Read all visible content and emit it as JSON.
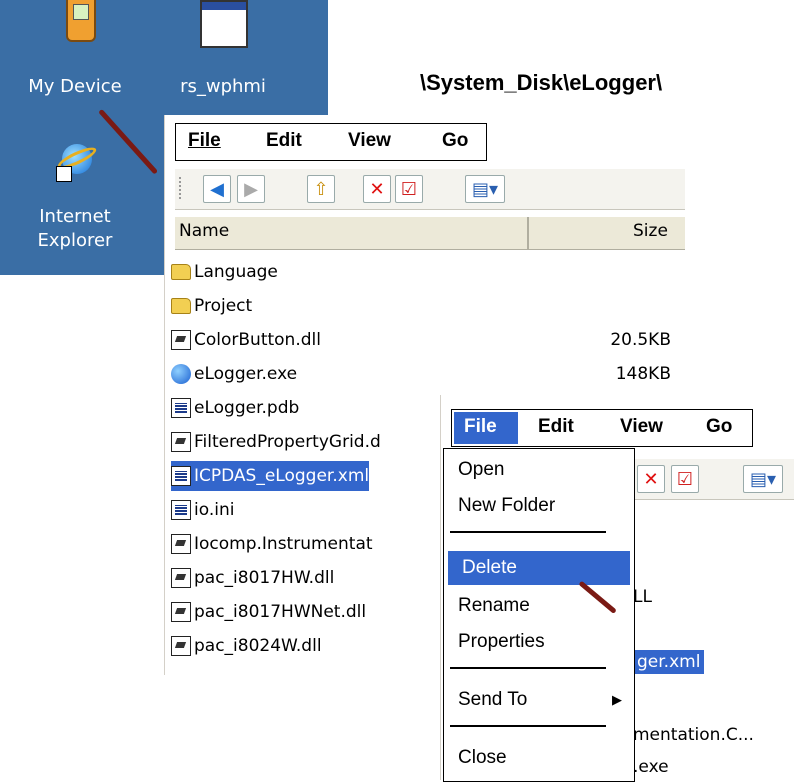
{
  "desktop": {
    "icons": [
      {
        "label": "My Device",
        "icon": "pda-icon"
      },
      {
        "label": "rs_wphmi",
        "icon": "window-icon"
      },
      {
        "label_line1": "Internet",
        "label_line2": "Explorer",
        "icon": "internet-explorer-icon"
      }
    ]
  },
  "path_label": "\\System_Disk\\eLogger\\",
  "explorer": {
    "menu": [
      "File",
      "Edit",
      "View",
      "Go"
    ],
    "toolbar": [
      "back-icon",
      "forward-icon",
      "up-folder-icon",
      "delete-icon",
      "properties-icon",
      "view-icon"
    ],
    "columns": {
      "name": "Name",
      "size": "Size"
    },
    "files": [
      {
        "name": "Language",
        "type": "folder",
        "size": ""
      },
      {
        "name": "Project",
        "type": "folder",
        "size": ""
      },
      {
        "name": "ColorButton.dll",
        "type": "dll",
        "size": "20.5KB"
      },
      {
        "name": "eLogger.exe",
        "type": "exe",
        "size": "148KB"
      },
      {
        "name": "eLogger.pdb",
        "type": "pdb",
        "size": ""
      },
      {
        "name": "FilteredPropertyGrid.d",
        "type": "dll",
        "size": ""
      },
      {
        "name": "ICPDAS_eLogger.xml",
        "type": "xml",
        "size": "",
        "selected": true
      },
      {
        "name": "io.ini",
        "type": "ini",
        "size": ""
      },
      {
        "name": "Iocomp.Instrumentat",
        "type": "dll",
        "size": ""
      },
      {
        "name": "pac_i8017HW.dll",
        "type": "dll",
        "size": ""
      },
      {
        "name": "pac_i8017HWNet.dll",
        "type": "dll",
        "size": ""
      },
      {
        "name": "pac_i8024W.dll",
        "type": "dll",
        "size": ""
      }
    ]
  },
  "second_window": {
    "menu": [
      "File",
      "Edit",
      "View",
      "Go"
    ],
    "partial_texts": [
      "LL",
      "ger.xml",
      "mentation.C...",
      ".exe"
    ]
  },
  "file_menu": {
    "items": [
      {
        "label": "Open",
        "underline": "O"
      },
      {
        "label": "New Folder",
        "underline": "N"
      },
      {
        "label": "Delete",
        "underline": "D",
        "highlighted": true
      },
      {
        "label": "Rename",
        "underline": "m"
      },
      {
        "label": "Properties",
        "underline": "r"
      },
      {
        "label": "Send To",
        "underline": "T",
        "submenu": true
      },
      {
        "label": "Close",
        "underline": "C"
      }
    ]
  },
  "colors": {
    "desktop": "#3a6ea5",
    "selection": "#3366cc",
    "arrow": "#7a1a14"
  }
}
